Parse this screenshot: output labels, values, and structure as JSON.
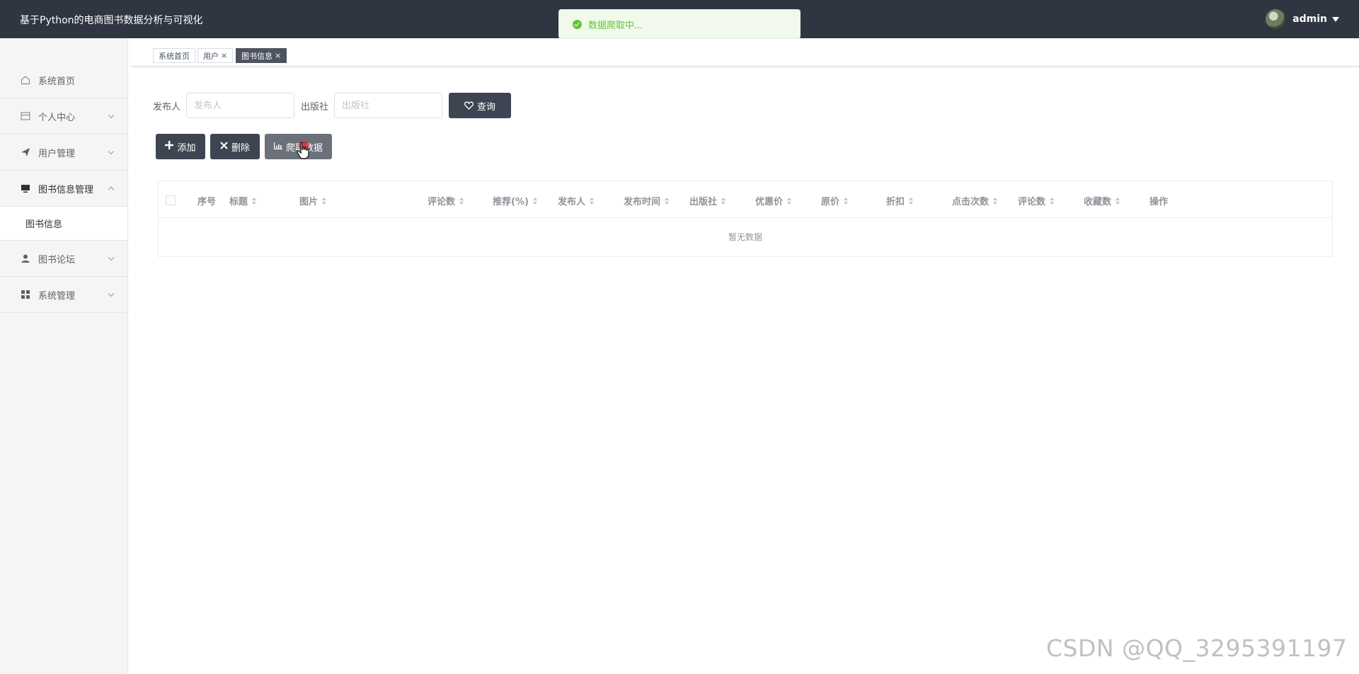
{
  "header": {
    "app_title": "基于Python的电商图书数据分析与可视化",
    "user_name": "admin"
  },
  "toast": {
    "message": "数据爬取中..."
  },
  "sidebar": {
    "items": [
      {
        "label": "系统首页",
        "icon": "home-icon"
      },
      {
        "label": "个人中心",
        "icon": "id-card-icon"
      },
      {
        "label": "用户管理",
        "icon": "paper-plane-icon"
      },
      {
        "label": "图书信息管理",
        "icon": "monitor-icon",
        "open": true
      },
      {
        "label": "图书论坛",
        "icon": "user-icon"
      },
      {
        "label": "系统管理",
        "icon": "grid-icon"
      }
    ],
    "submenu": {
      "label": "图书信息"
    }
  },
  "tabs": [
    {
      "label": "系统首页",
      "closable": false
    },
    {
      "label": "用户",
      "closable": true
    },
    {
      "label": "图书信息",
      "closable": true,
      "active": true
    }
  ],
  "tab_close_glyph": "×",
  "search": {
    "publisher_label": "发布人",
    "publisher_placeholder": "发布人",
    "press_label": "出版社",
    "press_placeholder": "出版社",
    "query_label": "查询"
  },
  "actions": {
    "add_label": "添加",
    "delete_label": "删除",
    "crawl_label": "爬取数据"
  },
  "table": {
    "columns": [
      "序号",
      "标题",
      "图片",
      "评论数",
      "推荐(%)",
      "发布人",
      "发布时间",
      "出版社",
      "优惠价",
      "原价",
      "折扣",
      "点击次数",
      "评论数",
      "收藏数",
      "操作"
    ],
    "empty_text": "暂无数据"
  },
  "watermark": "CSDN @QQ_3295391197"
}
